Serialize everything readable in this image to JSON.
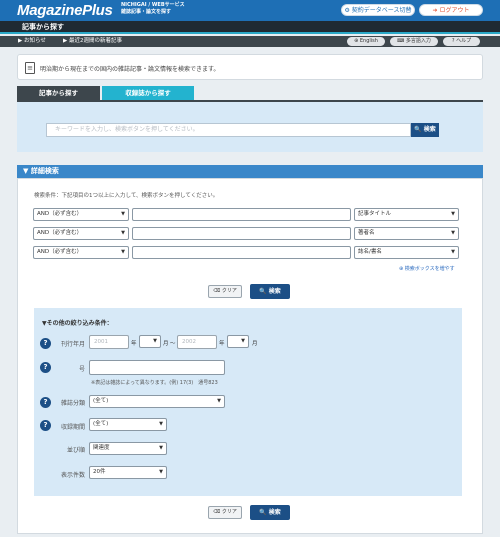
{
  "header": {
    "logo": "MagazinePlus",
    "sub1": "NICHIGAI / WEBサービス",
    "sub2": "雑誌記事・論文を探す",
    "db_button": "契約データベース切替",
    "logout_button": "ログアウト",
    "db_icon": "gear-circle-icon",
    "logout_icon": "arrow-right-icon"
  },
  "titlebar": {
    "title": "記事から探す"
  },
  "navbar": {
    "news": "お知らせ",
    "new_articles": "最近2週間の新着記事",
    "english": "English",
    "multilang": "多言語入力",
    "help": "ヘルプ"
  },
  "notice": {
    "text": "明治期から現在までの国内の雑誌記事・論文情報を検索できます。",
    "icon": "document-icon"
  },
  "tabs": {
    "active": "記事から探す",
    "inactive": "収録誌から探す"
  },
  "keyword": {
    "placeholder": "キーワードを入力し、検索ボタンを押してください。",
    "button": "検索"
  },
  "advanced": {
    "header": "▼ 詳細検索",
    "instruction": "検索条件：下記項目の1つ以上に入力して、検索ボタンを押してください。",
    "rows": [
      {
        "op": "AND（必ず含む）",
        "field": "記事タイトル"
      },
      {
        "op": "AND（必ず含む）",
        "field": "著者名"
      },
      {
        "op": "AND（必ず含む）",
        "field": "誌名/書名"
      }
    ],
    "add_box": "⊕ 検索ボックスを増やす",
    "clear": "クリア",
    "search": "検索"
  },
  "other": {
    "title": "▼その他の絞り込み条件：",
    "pubdate_label": "刊行年月",
    "year_from_placeholder": "2001",
    "year_unit": "年",
    "month_unit": "月",
    "tilde": "～",
    "year_to_placeholder": "2002",
    "issue_label": "号",
    "issue_note": "※表記は雑誌によって異なります。(例) 17(3)　通号823",
    "category_label": "雑誌分類",
    "category_value": "(全て)",
    "period_label": "収録期間",
    "period_value": "(全て)",
    "sort_label": "並び順",
    "sort_value": "関連度",
    "count_label": "表示件数",
    "count_value": "20件",
    "clear": "クリア",
    "search": "検索"
  },
  "colors": {
    "brand": "#1e6fb5",
    "accent": "#23b3cf",
    "dark": "#3d464c",
    "button": "#1c4f86"
  }
}
